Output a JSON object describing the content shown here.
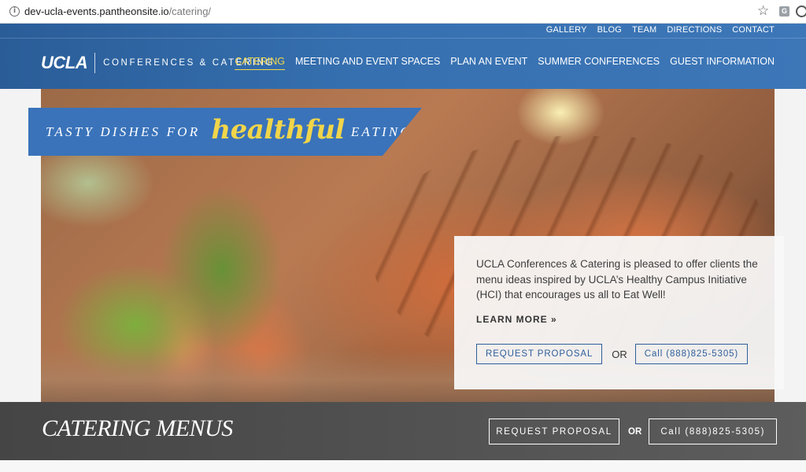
{
  "browser": {
    "url_host": "dev-ucla-events.pantheonsite.io",
    "url_path": "/catering/",
    "info_glyph": "i",
    "extension_label": "G"
  },
  "header": {
    "utility_nav": [
      "GALLERY",
      "BLOG",
      "TEAM",
      "DIRECTIONS",
      "CONTACT"
    ],
    "logo_primary": "UCLA",
    "logo_secondary": "CONFERENCES & CATERING",
    "main_nav": [
      {
        "label": "CATERING",
        "active": true
      },
      {
        "label": "MEETING AND EVENT SPACES",
        "active": false
      },
      {
        "label": "PLAN AN EVENT",
        "active": false
      },
      {
        "label": "SUMMER CONFERENCES",
        "active": false
      },
      {
        "label": "GUEST INFORMATION",
        "active": false
      }
    ]
  },
  "hero": {
    "tagline_pre": "TASTY DISHES FOR",
    "tagline_script": "healthful",
    "tagline_post": "EATING",
    "card_text": "UCLA Conferences & Catering is pleased to offer clients the menu ideas inspired by UCLA’s Healthy Campus Initiative (HCI) that encourages us all to Eat Well!",
    "learn_more": "LEARN MORE »",
    "request_label": "REQUEST PROPOSAL",
    "or_label": "OR",
    "call_label": "Call (888)825-5305)"
  },
  "band": {
    "title": "CATERING MENUS",
    "request_label": "REQUEST PROPOSAL",
    "or_label": "OR",
    "call_label": "Call (888)825-5305)"
  },
  "colors": {
    "brand_blue": "#3670b0",
    "active_nav": "#f5d84c",
    "script_yellow": "#f1d54a"
  }
}
